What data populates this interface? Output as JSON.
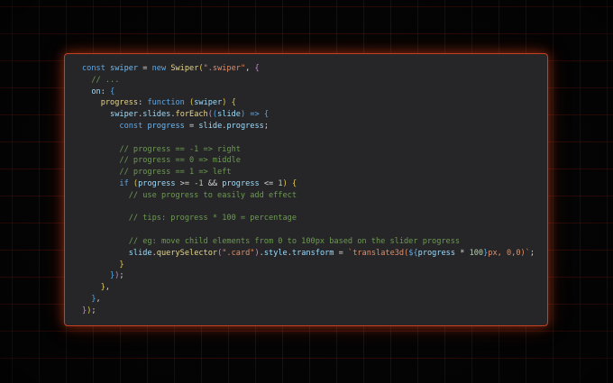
{
  "code": {
    "language": "javascript",
    "colors": {
      "background": "#262628",
      "border": "#c4411f",
      "keyword": "#5fa8e8",
      "function": "#e6d58a",
      "string": "#e08e68",
      "comment": "#6d9a52"
    },
    "lines": [
      [
        {
          "t": "const ",
          "c": "kw"
        },
        {
          "t": "swiper",
          "c": "var"
        },
        {
          "t": " = ",
          "c": "op"
        },
        {
          "t": "new ",
          "c": "kw"
        },
        {
          "t": "Swiper",
          "c": "fn"
        },
        {
          "t": "(",
          "c": "br1"
        },
        {
          "t": "\".swiper\"",
          "c": "str"
        },
        {
          "t": ", ",
          "c": "op"
        },
        {
          "t": "{",
          "c": "br2"
        }
      ],
      [
        {
          "t": "  // ...",
          "c": "cm"
        }
      ],
      [
        {
          "t": "  on",
          "c": "prop"
        },
        {
          "t": ": ",
          "c": "op"
        },
        {
          "t": "{",
          "c": "br3"
        }
      ],
      [
        {
          "t": "    progress",
          "c": "fn"
        },
        {
          "t": ": ",
          "c": "op"
        },
        {
          "t": "function ",
          "c": "kw"
        },
        {
          "t": "(",
          "c": "br1"
        },
        {
          "t": "swiper",
          "c": "prop"
        },
        {
          "t": ") ",
          "c": "br1"
        },
        {
          "t": "{",
          "c": "br1"
        }
      ],
      [
        {
          "t": "      swiper",
          "c": "prop"
        },
        {
          "t": ".",
          "c": "op"
        },
        {
          "t": "slides",
          "c": "prop"
        },
        {
          "t": ".",
          "c": "op"
        },
        {
          "t": "forEach",
          "c": "fn"
        },
        {
          "t": "(",
          "c": "br2"
        },
        {
          "t": "(",
          "c": "br3"
        },
        {
          "t": "slide",
          "c": "prop"
        },
        {
          "t": ")",
          "c": "br3"
        },
        {
          "t": " => ",
          "c": "kw"
        },
        {
          "t": "{",
          "c": "br3"
        }
      ],
      [
        {
          "t": "        const ",
          "c": "kw"
        },
        {
          "t": "progress",
          "c": "var"
        },
        {
          "t": " = ",
          "c": "op"
        },
        {
          "t": "slide",
          "c": "prop"
        },
        {
          "t": ".",
          "c": "op"
        },
        {
          "t": "progress",
          "c": "prop"
        },
        {
          "t": ";",
          "c": "op"
        }
      ],
      [
        {
          "t": "",
          "c": "plain"
        }
      ],
      [
        {
          "t": "        // progress == -1 => right",
          "c": "cm"
        }
      ],
      [
        {
          "t": "        // progress == 0 => middle",
          "c": "cm"
        }
      ],
      [
        {
          "t": "        // progress == 1 => left",
          "c": "cm"
        }
      ],
      [
        {
          "t": "        if ",
          "c": "kw"
        },
        {
          "t": "(",
          "c": "br1"
        },
        {
          "t": "progress",
          "c": "prop"
        },
        {
          "t": " >= ",
          "c": "op"
        },
        {
          "t": "-1",
          "c": "num"
        },
        {
          "t": " && ",
          "c": "op"
        },
        {
          "t": "progress",
          "c": "prop"
        },
        {
          "t": " <= ",
          "c": "op"
        },
        {
          "t": "1",
          "c": "num"
        },
        {
          "t": ") ",
          "c": "br1"
        },
        {
          "t": "{",
          "c": "br1"
        }
      ],
      [
        {
          "t": "          // use progress to easily add effect",
          "c": "cm"
        }
      ],
      [
        {
          "t": "",
          "c": "plain"
        }
      ],
      [
        {
          "t": "          // tips: progress * 100 = percentage",
          "c": "cm"
        }
      ],
      [
        {
          "t": "",
          "c": "plain"
        }
      ],
      [
        {
          "t": "          // eg: move child elements from 0 to 100px based on the slider progress",
          "c": "cm"
        }
      ],
      [
        {
          "t": "          slide",
          "c": "prop"
        },
        {
          "t": ".",
          "c": "op"
        },
        {
          "t": "querySelector",
          "c": "fn"
        },
        {
          "t": "(",
          "c": "br2"
        },
        {
          "t": "\".card\"",
          "c": "str"
        },
        {
          "t": ")",
          "c": "br2"
        },
        {
          "t": ".",
          "c": "op"
        },
        {
          "t": "style",
          "c": "prop"
        },
        {
          "t": ".",
          "c": "op"
        },
        {
          "t": "transform",
          "c": "prop"
        },
        {
          "t": " = ",
          "c": "op"
        },
        {
          "t": "`translate3d(",
          "c": "str"
        },
        {
          "t": "${",
          "c": "kw"
        },
        {
          "t": "progress",
          "c": "prop"
        },
        {
          "t": " * ",
          "c": "op"
        },
        {
          "t": "100",
          "c": "num"
        },
        {
          "t": "}",
          "c": "kw"
        },
        {
          "t": "px, 0,0)`",
          "c": "str"
        },
        {
          "t": ";",
          "c": "op"
        }
      ],
      [
        {
          "t": "        }",
          "c": "br1"
        }
      ],
      [
        {
          "t": "      ",
          "c": "plain"
        },
        {
          "t": "}",
          "c": "br3"
        },
        {
          "t": ")",
          "c": "br2"
        },
        {
          "t": ";",
          "c": "op"
        }
      ],
      [
        {
          "t": "    }",
          "c": "br1"
        },
        {
          "t": ",",
          "c": "op"
        }
      ],
      [
        {
          "t": "  }",
          "c": "br3"
        },
        {
          "t": ",",
          "c": "op"
        }
      ],
      [
        {
          "t": "}",
          "c": "br2"
        },
        {
          "t": ")",
          "c": "br1"
        },
        {
          "t": ";",
          "c": "op"
        }
      ]
    ]
  }
}
